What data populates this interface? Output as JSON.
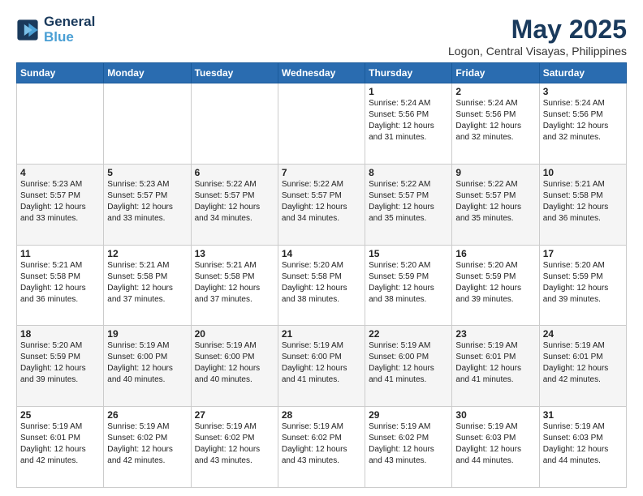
{
  "logo": {
    "line1": "General",
    "line2": "Blue"
  },
  "title": "May 2025",
  "location": "Logon, Central Visayas, Philippines",
  "weekdays": [
    "Sunday",
    "Monday",
    "Tuesday",
    "Wednesday",
    "Thursday",
    "Friday",
    "Saturday"
  ],
  "weeks": [
    [
      {
        "day": "",
        "content": ""
      },
      {
        "day": "",
        "content": ""
      },
      {
        "day": "",
        "content": ""
      },
      {
        "day": "",
        "content": ""
      },
      {
        "day": "1",
        "content": "Sunrise: 5:24 AM\nSunset: 5:56 PM\nDaylight: 12 hours\nand 31 minutes."
      },
      {
        "day": "2",
        "content": "Sunrise: 5:24 AM\nSunset: 5:56 PM\nDaylight: 12 hours\nand 32 minutes."
      },
      {
        "day": "3",
        "content": "Sunrise: 5:24 AM\nSunset: 5:56 PM\nDaylight: 12 hours\nand 32 minutes."
      }
    ],
    [
      {
        "day": "4",
        "content": "Sunrise: 5:23 AM\nSunset: 5:57 PM\nDaylight: 12 hours\nand 33 minutes."
      },
      {
        "day": "5",
        "content": "Sunrise: 5:23 AM\nSunset: 5:57 PM\nDaylight: 12 hours\nand 33 minutes."
      },
      {
        "day": "6",
        "content": "Sunrise: 5:22 AM\nSunset: 5:57 PM\nDaylight: 12 hours\nand 34 minutes."
      },
      {
        "day": "7",
        "content": "Sunrise: 5:22 AM\nSunset: 5:57 PM\nDaylight: 12 hours\nand 34 minutes."
      },
      {
        "day": "8",
        "content": "Sunrise: 5:22 AM\nSunset: 5:57 PM\nDaylight: 12 hours\nand 35 minutes."
      },
      {
        "day": "9",
        "content": "Sunrise: 5:22 AM\nSunset: 5:57 PM\nDaylight: 12 hours\nand 35 minutes."
      },
      {
        "day": "10",
        "content": "Sunrise: 5:21 AM\nSunset: 5:58 PM\nDaylight: 12 hours\nand 36 minutes."
      }
    ],
    [
      {
        "day": "11",
        "content": "Sunrise: 5:21 AM\nSunset: 5:58 PM\nDaylight: 12 hours\nand 36 minutes."
      },
      {
        "day": "12",
        "content": "Sunrise: 5:21 AM\nSunset: 5:58 PM\nDaylight: 12 hours\nand 37 minutes."
      },
      {
        "day": "13",
        "content": "Sunrise: 5:21 AM\nSunset: 5:58 PM\nDaylight: 12 hours\nand 37 minutes."
      },
      {
        "day": "14",
        "content": "Sunrise: 5:20 AM\nSunset: 5:58 PM\nDaylight: 12 hours\nand 38 minutes."
      },
      {
        "day": "15",
        "content": "Sunrise: 5:20 AM\nSunset: 5:59 PM\nDaylight: 12 hours\nand 38 minutes."
      },
      {
        "day": "16",
        "content": "Sunrise: 5:20 AM\nSunset: 5:59 PM\nDaylight: 12 hours\nand 39 minutes."
      },
      {
        "day": "17",
        "content": "Sunrise: 5:20 AM\nSunset: 5:59 PM\nDaylight: 12 hours\nand 39 minutes."
      }
    ],
    [
      {
        "day": "18",
        "content": "Sunrise: 5:20 AM\nSunset: 5:59 PM\nDaylight: 12 hours\nand 39 minutes."
      },
      {
        "day": "19",
        "content": "Sunrise: 5:19 AM\nSunset: 6:00 PM\nDaylight: 12 hours\nand 40 minutes."
      },
      {
        "day": "20",
        "content": "Sunrise: 5:19 AM\nSunset: 6:00 PM\nDaylight: 12 hours\nand 40 minutes."
      },
      {
        "day": "21",
        "content": "Sunrise: 5:19 AM\nSunset: 6:00 PM\nDaylight: 12 hours\nand 41 minutes."
      },
      {
        "day": "22",
        "content": "Sunrise: 5:19 AM\nSunset: 6:00 PM\nDaylight: 12 hours\nand 41 minutes."
      },
      {
        "day": "23",
        "content": "Sunrise: 5:19 AM\nSunset: 6:01 PM\nDaylight: 12 hours\nand 41 minutes."
      },
      {
        "day": "24",
        "content": "Sunrise: 5:19 AM\nSunset: 6:01 PM\nDaylight: 12 hours\nand 42 minutes."
      }
    ],
    [
      {
        "day": "25",
        "content": "Sunrise: 5:19 AM\nSunset: 6:01 PM\nDaylight: 12 hours\nand 42 minutes."
      },
      {
        "day": "26",
        "content": "Sunrise: 5:19 AM\nSunset: 6:02 PM\nDaylight: 12 hours\nand 42 minutes."
      },
      {
        "day": "27",
        "content": "Sunrise: 5:19 AM\nSunset: 6:02 PM\nDaylight: 12 hours\nand 43 minutes."
      },
      {
        "day": "28",
        "content": "Sunrise: 5:19 AM\nSunset: 6:02 PM\nDaylight: 12 hours\nand 43 minutes."
      },
      {
        "day": "29",
        "content": "Sunrise: 5:19 AM\nSunset: 6:02 PM\nDaylight: 12 hours\nand 43 minutes."
      },
      {
        "day": "30",
        "content": "Sunrise: 5:19 AM\nSunset: 6:03 PM\nDaylight: 12 hours\nand 44 minutes."
      },
      {
        "day": "31",
        "content": "Sunrise: 5:19 AM\nSunset: 6:03 PM\nDaylight: 12 hours\nand 44 minutes."
      }
    ]
  ]
}
